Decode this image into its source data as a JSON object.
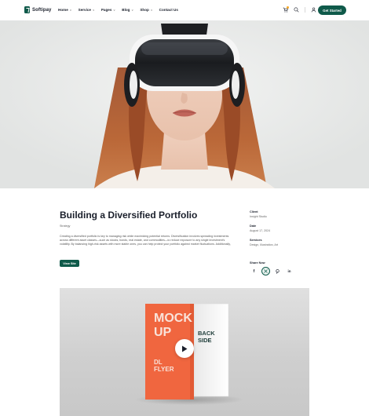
{
  "brand": {
    "name": "Softipay",
    "accent": "#0f5a4a"
  },
  "nav": {
    "items": [
      {
        "label": "Home"
      },
      {
        "label": "Service"
      },
      {
        "label": "Pages"
      },
      {
        "label": "Blog"
      },
      {
        "label": "Shop"
      },
      {
        "label": "Contact Us"
      }
    ],
    "cta": "Get Started"
  },
  "header_icons": [
    "cart-icon",
    "search-icon",
    "user-icon"
  ],
  "project": {
    "title": "Building a Diversified Portfolio",
    "category": "Strategy",
    "description": "Creating a diversified portfolio is key to managing risk while maximizing potential returns. Diversification involves spreading investments across different asset classes—such as stocks, bonds, real estate, and commodities—to reduce exposure to any single investment's volatility. By balancing high-risk assets with more stable ones, you can help protect your portfolio against market fluctuations. Additionally,",
    "button": "View Site"
  },
  "meta": [
    {
      "label": "Client",
      "value": "Insight Studio"
    },
    {
      "label": "Date",
      "value": "August 17, 2024"
    },
    {
      "label": "Services",
      "value": "Design, Illustration, Art"
    }
  ],
  "share": {
    "label": "Share Now",
    "icons": [
      "facebook-icon",
      "x-icon",
      "pinterest-icon",
      "linkedin-icon"
    ]
  },
  "mockup": {
    "front_lines": [
      "MOCK",
      "UP"
    ],
    "front_bottom": [
      "DL",
      "FLYER"
    ],
    "back_lines": [
      "BACK",
      "SIDE"
    ],
    "front_color": "#f0663f"
  }
}
